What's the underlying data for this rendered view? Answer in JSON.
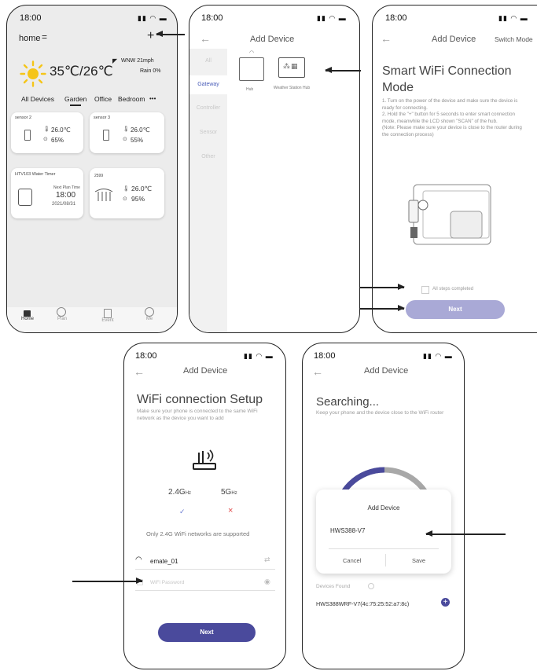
{
  "colors": {
    "accent": "#4a4a9c",
    "next_disabled": "#a9a9d6",
    "phone_bg_home": "#ececec",
    "sun": "#f5c518"
  },
  "status_bar": {
    "time": "18:00",
    "icons": "ull ◥ ▬"
  },
  "home": {
    "title": "home",
    "menu_icon": "menu-icon",
    "add_icon_glyph": "+",
    "temp": "35℃/26℃",
    "wind": "WNW 21mph",
    "rain": "Rain 0%",
    "rooms": [
      "All Devices",
      "Garden",
      "Office",
      "Bedroom",
      "•••"
    ],
    "devices": [
      {
        "name": "sensor 2",
        "temp": "26.0℃",
        "hum": "65%"
      },
      {
        "name": "sensor 3",
        "temp": "26.0℃",
        "hum": "55%"
      }
    ],
    "timer": {
      "name": "HTV103 Water Timer",
      "label": "Next Plan Time",
      "time": "18:00",
      "date": "2021/08/31"
    },
    "station": {
      "name": "2599",
      "temp": "26.0℃",
      "hum": "95%"
    },
    "tabbar": [
      "Home",
      "Plan",
      "Event",
      "Me"
    ]
  },
  "add_device": {
    "title": "Add Device",
    "back": "←",
    "categories": [
      "All",
      "Gateway",
      "Controller",
      "Sensor",
      "Other"
    ],
    "items": [
      "Hub",
      "Weather Station Hub"
    ]
  },
  "smart": {
    "title": "Add Device",
    "switch_mode": "Switch Mode",
    "heading": "Smart WiFi Connection Mode",
    "steps": [
      "1. Turn on the power of the device and make sure the device is ready for connecting.",
      "2. Hold the \"+\" button for 5 seconds to enter smart connection mode, meanwhile the LCD shown \"SCAN\" of the hub.",
      "(Note: Please make sure your device is close to the router during the connection process)"
    ],
    "checkbox_label": "All steps completed",
    "next": "Next"
  },
  "wifi": {
    "title": "Add Device",
    "heading": "WiFi connection Setup",
    "desc": "Make sure your phone is connected to the same WiFi network as the device you want to add",
    "band_24": "2.4G",
    "band_24_unit": "Hz",
    "band_5": "5G",
    "band_5_unit": "Hz",
    "check": "✓",
    "cross": "×",
    "note": "Only 2.4G WiFi networks are supported",
    "ssid": "emate_01",
    "password_placeholder": "WiFi Password",
    "next": "Next"
  },
  "search": {
    "title": "Add Device",
    "heading": "Searching...",
    "desc": "Keep your phone and the device close to the WiFi router",
    "dialog_title": "Add Device",
    "dialog_value": "HWS388-V7",
    "cancel": "Cancel",
    "save": "Save",
    "found_label": "Devices Found",
    "found_device": "HWS388WRF-V7(4c:75:25:52:a7:8c)",
    "progress": 0.4
  }
}
